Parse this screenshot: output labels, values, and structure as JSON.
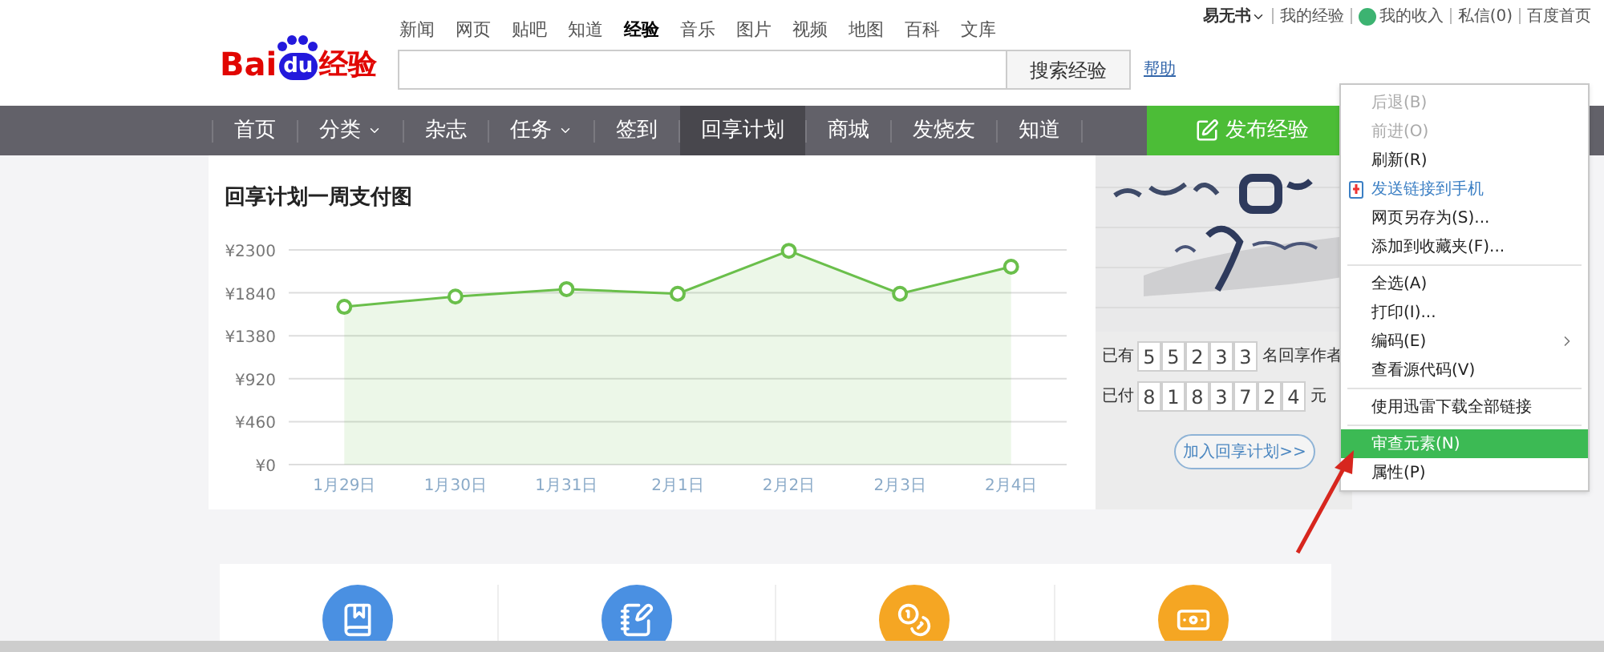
{
  "header": {
    "logo": {
      "left": "Bai",
      "paw": "du",
      "right": "经验"
    },
    "channels": [
      {
        "label": "新闻",
        "selected": false
      },
      {
        "label": "网页",
        "selected": false
      },
      {
        "label": "贴吧",
        "selected": false
      },
      {
        "label": "知道",
        "selected": false
      },
      {
        "label": "经验",
        "selected": true
      },
      {
        "label": "音乐",
        "selected": false
      },
      {
        "label": "图片",
        "selected": false
      },
      {
        "label": "视频",
        "selected": false
      },
      {
        "label": "地图",
        "selected": false
      },
      {
        "label": "百科",
        "selected": false
      },
      {
        "label": "文库",
        "selected": false
      }
    ],
    "search_button": "搜索经验",
    "help_link": "帮助",
    "user_links": [
      {
        "kind": "user",
        "label": "易无书"
      },
      {
        "kind": "link",
        "label": "我的经验"
      },
      {
        "kind": "income",
        "label": "我的收入"
      },
      {
        "kind": "link",
        "label": "私信(0)"
      },
      {
        "kind": "link",
        "label": "百度首页"
      }
    ]
  },
  "nav": {
    "items": [
      {
        "label": "首页",
        "selected": false,
        "has_menu": false
      },
      {
        "label": "分类",
        "selected": false,
        "has_menu": true
      },
      {
        "label": "杂志",
        "selected": false,
        "has_menu": false
      },
      {
        "label": "任务",
        "selected": false,
        "has_menu": true
      },
      {
        "label": "签到",
        "selected": false,
        "has_menu": false
      },
      {
        "label": "回享计划",
        "selected": true,
        "has_menu": false
      },
      {
        "label": "商城",
        "selected": false,
        "has_menu": false
      },
      {
        "label": "发烧友",
        "selected": false,
        "has_menu": false
      },
      {
        "label": "知道",
        "selected": false,
        "has_menu": false
      }
    ],
    "publish_button": "发布经验"
  },
  "chart_panel": {
    "title": "回享计划一周支付图",
    "chart_data": {
      "type": "area",
      "categories": [
        "1月29日",
        "1月30日",
        "1月31日",
        "2月1日",
        "2月2日",
        "2月3日",
        "2月4日"
      ],
      "grid": true,
      "series": [
        {
          "color": "#6abf4b",
          "values": [
            1690,
            1800,
            1880,
            1830,
            2290,
            1830,
            2120
          ]
        }
      ],
      "ylim": [
        0,
        2300
      ],
      "yticks": [
        {
          "value": 0,
          "label": "¥0"
        },
        {
          "value": 460,
          "label": "¥460"
        },
        {
          "value": 920,
          "label": "¥920"
        },
        {
          "value": 1380,
          "label": "¥1380"
        },
        {
          "value": 1840,
          "label": "¥1840"
        },
        {
          "value": 2300,
          "label": "¥2300"
        }
      ]
    }
  },
  "banner": {
    "counters": [
      {
        "prefix": "已有",
        "digits": [
          "5",
          "5",
          "2",
          "3",
          "3"
        ],
        "suffix": "名回享作者"
      },
      {
        "prefix": "已付",
        "digits": [
          "8",
          "1",
          "8",
          "3",
          "7",
          "2",
          "4"
        ],
        "suffix": "元"
      }
    ],
    "join_button": "加入回享计划>>"
  },
  "features": [
    {
      "kind": "book"
    },
    {
      "kind": "notes"
    },
    {
      "kind": "moneybag"
    },
    {
      "kind": "cash"
    }
  ],
  "context_menu": {
    "items": [
      {
        "kind": "item",
        "label": "后退(B)",
        "disabled": true,
        "selected": false
      },
      {
        "kind": "item",
        "label": "前进(O)",
        "disabled": true,
        "selected": false
      },
      {
        "kind": "item",
        "label": "刷新(R)",
        "disabled": false,
        "selected": false
      },
      {
        "kind": "phone",
        "label": "发送链接到手机",
        "disabled": false,
        "selected": false
      },
      {
        "kind": "item",
        "label": "网页另存为(S)...",
        "disabled": false,
        "selected": false
      },
      {
        "kind": "item",
        "label": "添加到收藏夹(F)...",
        "disabled": false,
        "selected": false
      },
      {
        "kind": "separator"
      },
      {
        "kind": "item",
        "label": "全选(A)",
        "disabled": false,
        "selected": false
      },
      {
        "kind": "item",
        "label": "打印(I)...",
        "disabled": false,
        "selected": false
      },
      {
        "kind": "submenu",
        "label": "编码(E)",
        "disabled": false,
        "selected": false
      },
      {
        "kind": "item",
        "label": "查看源代码(V)",
        "disabled": false,
        "selected": false
      },
      {
        "kind": "separator"
      },
      {
        "kind": "item",
        "label": "使用迅雷下载全部链接",
        "disabled": false,
        "selected": false
      },
      {
        "kind": "separator"
      },
      {
        "kind": "item",
        "label": "审查元素(N)",
        "disabled": false,
        "selected": true
      },
      {
        "kind": "item",
        "label": "属性(P)",
        "disabled": false,
        "selected": false
      }
    ]
  }
}
